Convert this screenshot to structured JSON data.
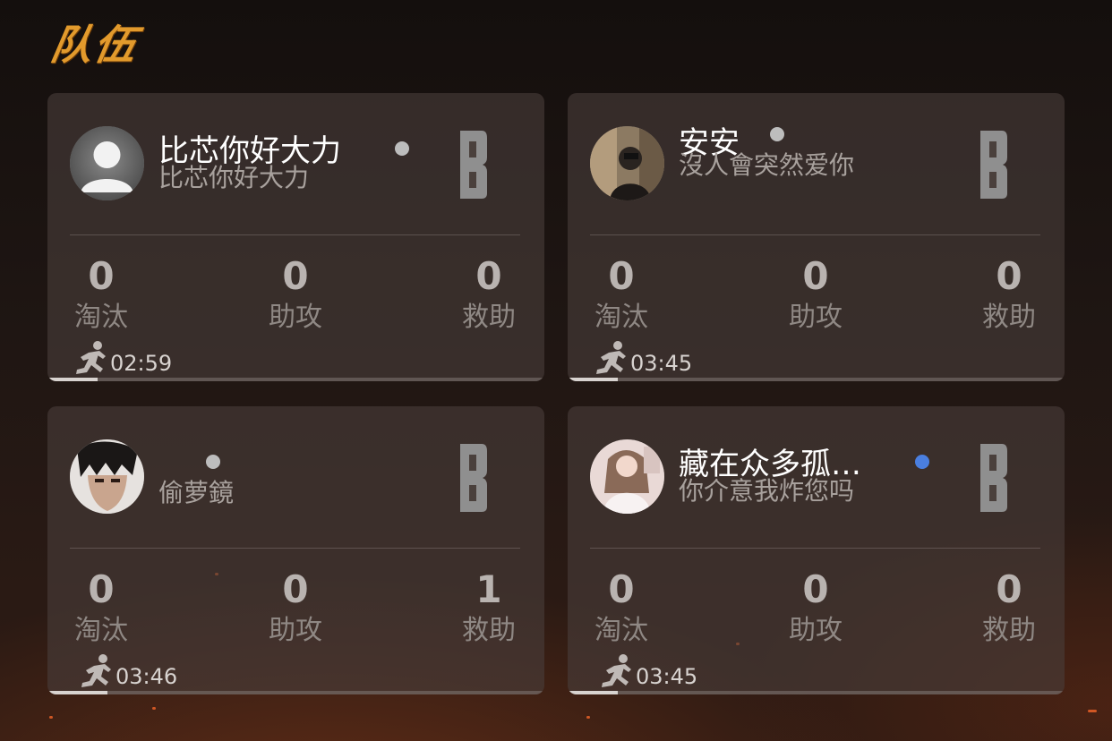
{
  "section": {
    "title": "队伍"
  },
  "colors": {
    "title": "#e29a2c",
    "dot_offline": "#bdbdbd",
    "dot_online": "#4a7fe0"
  },
  "members": [
    {
      "name": "比芯你好大力",
      "signature": "比芯你好大力",
      "avatar_icon": "default-person-avatar",
      "status_dot": "offline",
      "stats": {
        "eliminations": "0",
        "assists": "0",
        "rescues": "0"
      },
      "labels": {
        "eliminations": "淘汰",
        "assists": "助攻",
        "rescues": "救助"
      },
      "time": "02:59",
      "progress": 0.1
    },
    {
      "name": "安安",
      "signature": "沒人會突然爱你",
      "avatar_icon": "photo-avatar",
      "status_dot": "offline",
      "stats": {
        "eliminations": "0",
        "assists": "0",
        "rescues": "0"
      },
      "labels": {
        "eliminations": "淘汰",
        "assists": "助攻",
        "rescues": "救助"
      },
      "time": "03:45",
      "progress": 0.1
    },
    {
      "name": "",
      "signature": "偷萝鏡",
      "avatar_icon": "anime-avatar",
      "status_dot": "offline",
      "stats": {
        "eliminations": "0",
        "assists": "0",
        "rescues": "1"
      },
      "labels": {
        "eliminations": "淘汰",
        "assists": "助攻",
        "rescues": "救助"
      },
      "time": "03:46",
      "progress": 0.12
    },
    {
      "name": "藏在众多孤…",
      "signature": "你介意我炸您吗",
      "avatar_icon": "girl-photo-avatar",
      "status_dot": "online",
      "stats": {
        "eliminations": "0",
        "assists": "0",
        "rescues": "0"
      },
      "labels": {
        "eliminations": "淘汰",
        "assists": "助攻",
        "rescues": "救助"
      },
      "time": "03:45",
      "progress": 0.1
    }
  ]
}
